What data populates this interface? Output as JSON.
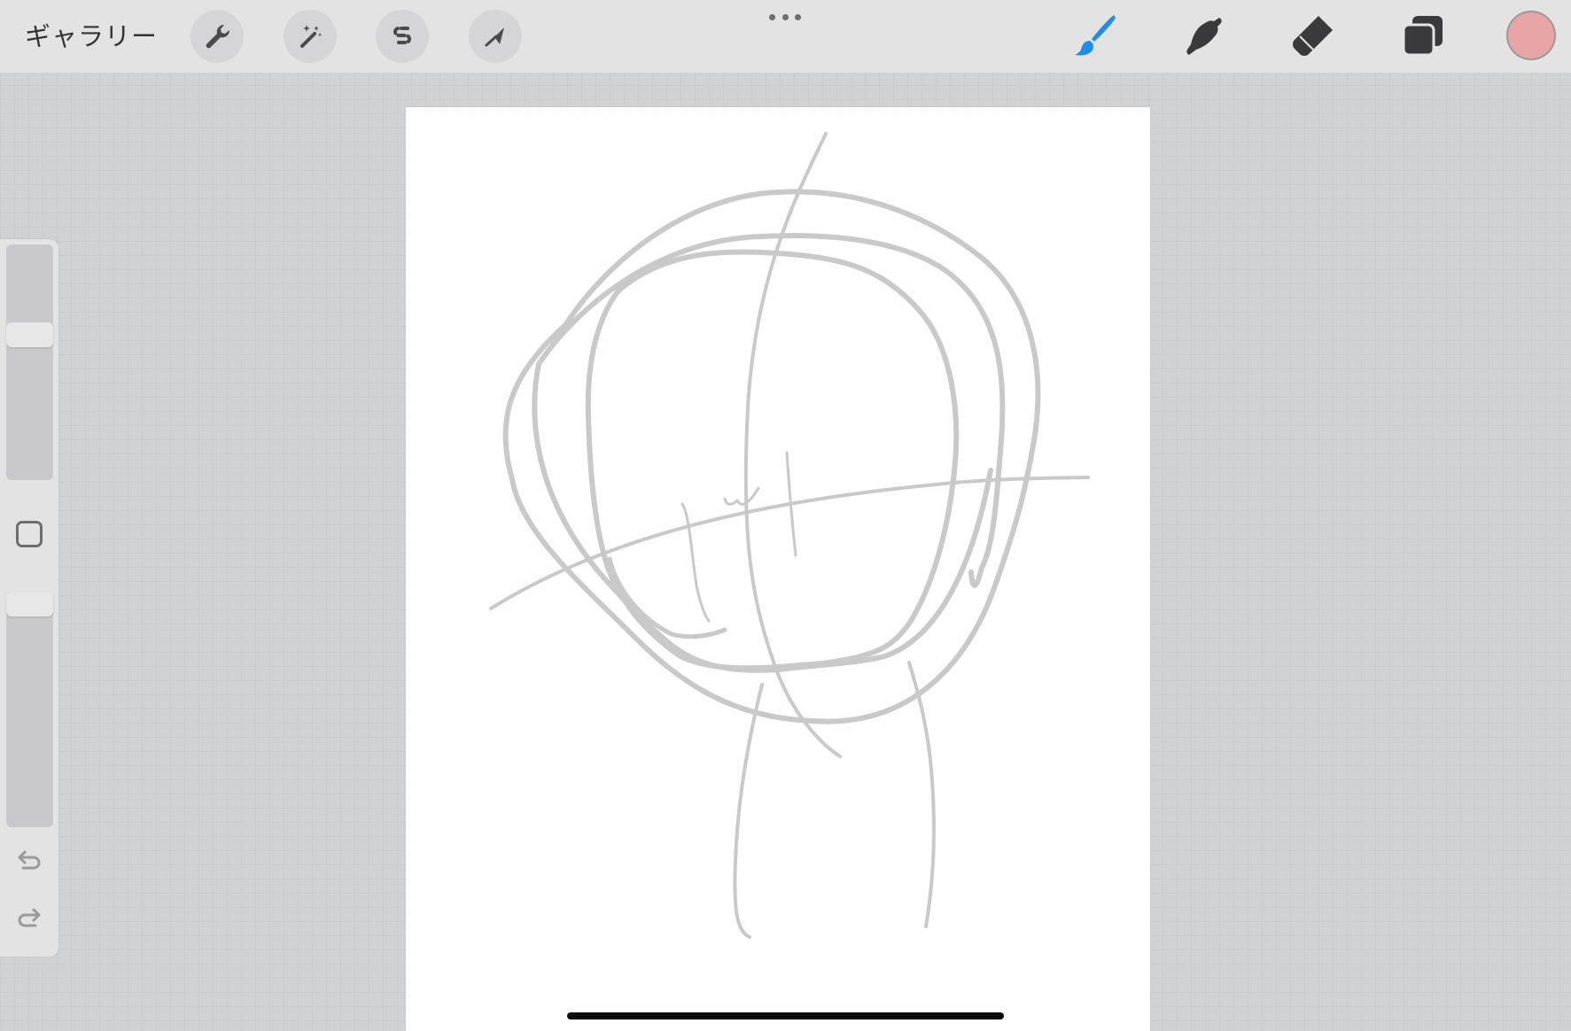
{
  "toolbar": {
    "gallery_label": "ギャラリー",
    "left_tools": [
      {
        "icon": "wrench-icon",
        "name": "actions"
      },
      {
        "icon": "magic-wand-icon",
        "name": "adjustments"
      },
      {
        "icon": "selection-s-icon",
        "name": "selection"
      },
      {
        "icon": "arrow-cursor-icon",
        "name": "transform"
      }
    ],
    "right_tools": [
      {
        "icon": "brush-icon",
        "name": "paint",
        "active": true
      },
      {
        "icon": "smudge-icon",
        "name": "smudge",
        "active": false
      },
      {
        "icon": "eraser-icon",
        "name": "erase",
        "active": false
      },
      {
        "icon": "layers-icon",
        "name": "layers",
        "active": false
      }
    ],
    "current_color": "#e8a5a5"
  },
  "sidebar": {
    "brush_size_level": 0.63,
    "opacity_level": 1.0,
    "undo_icon": "undo-arrow-icon",
    "redo_icon": "redo-arrow-icon",
    "modify_icon": "square-modify-icon"
  },
  "colors": {
    "accent_blue": "#1e8cf0",
    "stroke_gray": "#c9c9c9",
    "icon_dark": "#333333"
  }
}
